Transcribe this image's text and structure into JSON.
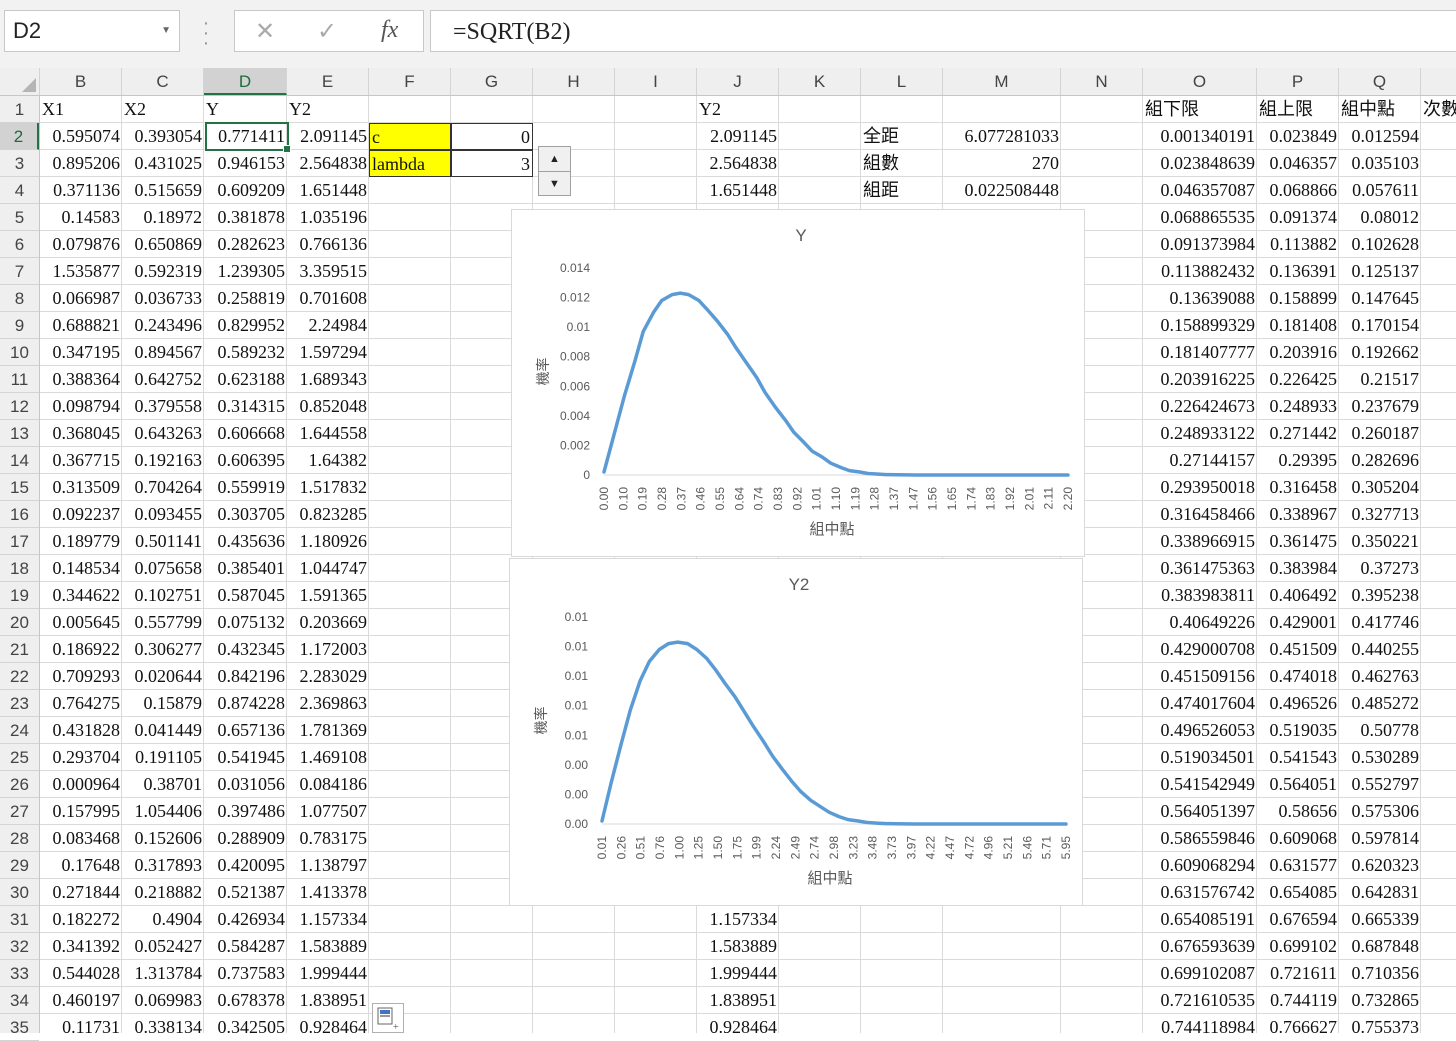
{
  "name_box": "D2",
  "formula": "=SQRT(B2)",
  "toolbar": {
    "cancel": "✕",
    "enter": "✓",
    "fx": "fx"
  },
  "columns": [
    "B",
    "C",
    "D",
    "E",
    "F",
    "G",
    "H",
    "I",
    "J",
    "K",
    "L",
    "M",
    "N",
    "O",
    "P",
    "Q"
  ],
  "selected_column": "D",
  "rows": [
    "1",
    "2",
    "3",
    "4",
    "5",
    "6",
    "7",
    "8",
    "9",
    "10",
    "11",
    "12",
    "13",
    "14",
    "15",
    "16",
    "17",
    "18",
    "19",
    "20",
    "21",
    "22",
    "23",
    "24",
    "25",
    "26",
    "27",
    "28",
    "29",
    "30",
    "31",
    "32",
    "33",
    "34",
    "35"
  ],
  "selected_row": "2",
  "headers": {
    "B": "X1",
    "C": "X2",
    "D": "Y",
    "E": "Y2",
    "J": "Y2",
    "O": "組下限",
    "P": "組上限",
    "Q": "組中點",
    "R": "次數"
  },
  "data_rows": [
    [
      "0.595074",
      "0.393054",
      "0.771411",
      "2.091145"
    ],
    [
      "0.895206",
      "0.431025",
      "0.946153",
      "2.564838"
    ],
    [
      "0.371136",
      "0.515659",
      "0.609209",
      "1.651448"
    ],
    [
      "0.14583",
      "0.18972",
      "0.381878",
      "1.035196"
    ],
    [
      "0.079876",
      "0.650869",
      "0.282623",
      "0.766136"
    ],
    [
      "1.535877",
      "0.592319",
      "1.239305",
      "3.359515"
    ],
    [
      "0.066987",
      "0.036733",
      "0.258819",
      "0.701608"
    ],
    [
      "0.688821",
      "0.243496",
      "0.829952",
      "2.24984"
    ],
    [
      "0.347195",
      "0.894567",
      "0.589232",
      "1.597294"
    ],
    [
      "0.388364",
      "0.642752",
      "0.623188",
      "1.689343"
    ],
    [
      "0.098794",
      "0.379558",
      "0.314315",
      "0.852048"
    ],
    [
      "0.368045",
      "0.643263",
      "0.606668",
      "1.644558"
    ],
    [
      "0.367715",
      "0.192163",
      "0.606395",
      "1.64382"
    ],
    [
      "0.313509",
      "0.704264",
      "0.559919",
      "1.517832"
    ],
    [
      "0.092237",
      "0.093455",
      "0.303705",
      "0.823285"
    ],
    [
      "0.189779",
      "0.501141",
      "0.435636",
      "1.180926"
    ],
    [
      "0.148534",
      "0.075658",
      "0.385401",
      "1.044747"
    ],
    [
      "0.344622",
      "0.102751",
      "0.587045",
      "1.591365"
    ],
    [
      "0.005645",
      "0.557799",
      "0.075132",
      "0.203669"
    ],
    [
      "0.186922",
      "0.306277",
      "0.432345",
      "1.172003"
    ],
    [
      "0.709293",
      "0.020644",
      "0.842196",
      "2.283029"
    ],
    [
      "0.764275",
      "0.15879",
      "0.874228",
      "2.369863"
    ],
    [
      "0.431828",
      "0.041449",
      "0.657136",
      "1.781369"
    ],
    [
      "0.293704",
      "0.191105",
      "0.541945",
      "1.469108"
    ],
    [
      "0.000964",
      "0.38701",
      "0.031056",
      "0.084186"
    ],
    [
      "0.157995",
      "1.054406",
      "0.397486",
      "1.077507"
    ],
    [
      "0.083468",
      "0.152606",
      "0.288909",
      "0.783175"
    ],
    [
      "0.17648",
      "0.317893",
      "0.420095",
      "1.138797"
    ],
    [
      "0.271844",
      "0.218882",
      "0.521387",
      "1.413378"
    ],
    [
      "0.182272",
      "0.4904",
      "0.426934",
      "1.157334"
    ],
    [
      "0.341392",
      "0.052427",
      "0.584287",
      "1.583889"
    ],
    [
      "0.544028",
      "1.313784",
      "0.737583",
      "1.999444"
    ],
    [
      "0.460197",
      "0.069983",
      "0.678378",
      "1.838951"
    ],
    [
      "0.11731",
      "0.338134",
      "0.342505",
      "0.928464"
    ]
  ],
  "params": {
    "c_label": "c",
    "c_value": "0",
    "lambda_label": "lambda",
    "lambda_value": "3"
  },
  "j_values": {
    "row2": "2.091145",
    "row3": "2.564838",
    "row4": "1.651448",
    "row31": "1.157334",
    "row32": "1.583889",
    "row33": "1.999444",
    "row34": "1.838951",
    "row35": "0.928464"
  },
  "stats": [
    {
      "label": "全距",
      "value": "6.077281033"
    },
    {
      "label": "組數",
      "value": "270"
    },
    {
      "label": "組距",
      "value": "0.022508448"
    }
  ],
  "bins": [
    [
      "0.001340191",
      "0.023849",
      "0.012594"
    ],
    [
      "0.023848639",
      "0.046357",
      "0.035103"
    ],
    [
      "0.046357087",
      "0.068866",
      "0.057611"
    ],
    [
      "0.068865535",
      "0.091374",
      "0.08012"
    ],
    [
      "0.091373984",
      "0.113882",
      "0.102628"
    ],
    [
      "0.113882432",
      "0.136391",
      "0.125137"
    ],
    [
      "0.13639088",
      "0.158899",
      "0.147645"
    ],
    [
      "0.158899329",
      "0.181408",
      "0.170154"
    ],
    [
      "0.181407777",
      "0.203916",
      "0.192662"
    ],
    [
      "0.203916225",
      "0.226425",
      "0.21517"
    ],
    [
      "0.226424673",
      "0.248933",
      "0.237679"
    ],
    [
      "0.248933122",
      "0.271442",
      "0.260187"
    ],
    [
      "0.27144157",
      "0.29395",
      "0.282696"
    ],
    [
      "0.293950018",
      "0.316458",
      "0.305204"
    ],
    [
      "0.316458466",
      "0.338967",
      "0.327713"
    ],
    [
      "0.338966915",
      "0.361475",
      "0.350221"
    ],
    [
      "0.361475363",
      "0.383984",
      "0.37273"
    ],
    [
      "0.383983811",
      "0.406492",
      "0.395238"
    ],
    [
      "0.40649226",
      "0.429001",
      "0.417746"
    ],
    [
      "0.429000708",
      "0.451509",
      "0.440255"
    ],
    [
      "0.451509156",
      "0.474018",
      "0.462763"
    ],
    [
      "0.474017604",
      "0.496526",
      "0.485272"
    ],
    [
      "0.496526053",
      "0.519035",
      "0.50778"
    ],
    [
      "0.519034501",
      "0.541543",
      "0.530289"
    ],
    [
      "0.541542949",
      "0.564051",
      "0.552797"
    ],
    [
      "0.564051397",
      "0.58656",
      "0.575306"
    ],
    [
      "0.586559846",
      "0.609068",
      "0.597814"
    ],
    [
      "0.609068294",
      "0.631577",
      "0.620323"
    ],
    [
      "0.631576742",
      "0.654085",
      "0.642831"
    ],
    [
      "0.654085191",
      "0.676594",
      "0.665339"
    ],
    [
      "0.676593639",
      "0.699102",
      "0.687848"
    ],
    [
      "0.699102087",
      "0.721611",
      "0.710356"
    ],
    [
      "0.721610535",
      "0.744119",
      "0.732865"
    ],
    [
      "0.744118984",
      "0.766627",
      "0.755373"
    ]
  ],
  "icons": {
    "spinner_up": "spin-up-icon",
    "spinner_down": "spin-down-icon",
    "paste_options": "paste-options-icon"
  },
  "colors": {
    "line": "#5b9bd5",
    "param_fill": "#ffff00",
    "selection": "#217346"
  },
  "chart_data": [
    {
      "type": "line",
      "title": "Y",
      "xlabel": "組中點",
      "ylabel": "機率",
      "ylim": [
        0,
        0.014
      ],
      "yticks": [
        "0",
        "0.002",
        "0.004",
        "0.006",
        "0.008",
        "0.01",
        "0.012",
        "0.014"
      ],
      "xticks": [
        "0.00",
        "0.10",
        "0.19",
        "0.28",
        "0.37",
        "0.46",
        "0.55",
        "0.64",
        "0.74",
        "0.83",
        "0.92",
        "1.01",
        "1.10",
        "1.19",
        "1.28",
        "1.37",
        "1.47",
        "1.56",
        "1.65",
        "1.74",
        "1.83",
        "1.92",
        "2.01",
        "2.11",
        "2.20"
      ],
      "x": [
        0.0,
        0.05,
        0.1,
        0.15,
        0.19,
        0.24,
        0.28,
        0.33,
        0.37,
        0.41,
        0.46,
        0.5,
        0.55,
        0.6,
        0.64,
        0.69,
        0.74,
        0.78,
        0.83,
        0.88,
        0.92,
        0.97,
        1.01,
        1.06,
        1.1,
        1.15,
        1.19,
        1.24,
        1.28,
        1.33,
        1.37,
        1.42,
        1.47,
        1.51,
        1.56,
        1.6,
        1.65,
        1.7,
        1.74,
        1.79,
        1.83,
        1.88,
        1.92,
        1.97,
        2.01,
        2.06,
        2.11,
        2.15,
        2.2,
        2.25
      ],
      "values": [
        0.0002,
        0.0028,
        0.0054,
        0.0077,
        0.0097,
        0.011,
        0.0118,
        0.0122,
        0.0123,
        0.0122,
        0.0118,
        0.0112,
        0.0104,
        0.0095,
        0.0086,
        0.0076,
        0.0066,
        0.0056,
        0.0046,
        0.0037,
        0.0029,
        0.0022,
        0.0016,
        0.0012,
        0.0008,
        0.0005,
        0.0003,
        0.0002,
        0.0001,
        6e-05,
        3e-05,
        2e-05,
        1e-05,
        0,
        0,
        0,
        0,
        0,
        0,
        0,
        0,
        0,
        0,
        0,
        0,
        0,
        0,
        0,
        0,
        0
      ]
    },
    {
      "type": "line",
      "title": "Y2",
      "xlabel": "組中點",
      "ylabel": "機率",
      "ylim": [
        0,
        0.014
      ],
      "yticks": [
        "0.00",
        "0.00",
        "0.00",
        "0.01",
        "0.01",
        "0.01",
        "0.01",
        "0.01"
      ],
      "xticks": [
        "0.01",
        "0.26",
        "0.51",
        "0.76",
        "1.00",
        "1.25",
        "1.50",
        "1.75",
        "1.99",
        "2.24",
        "2.49",
        "2.74",
        "2.98",
        "3.23",
        "3.48",
        "3.73",
        "3.97",
        "4.22",
        "4.47",
        "4.72",
        "4.96",
        "5.21",
        "5.46",
        "5.71",
        "5.95"
      ],
      "x": [
        0.01,
        0.13,
        0.26,
        0.38,
        0.51,
        0.63,
        0.76,
        0.88,
        1.0,
        1.13,
        1.25,
        1.38,
        1.5,
        1.62,
        1.75,
        1.87,
        1.99,
        2.12,
        2.24,
        2.37,
        2.49,
        2.61,
        2.74,
        2.86,
        2.98,
        3.11,
        3.23,
        3.36,
        3.48,
        3.6,
        3.73,
        3.85,
        3.97,
        4.1,
        4.22,
        4.35,
        4.47,
        4.59,
        4.72,
        4.84,
        4.96,
        5.09,
        5.21,
        5.34,
        5.46,
        5.58,
        5.71,
        5.83,
        5.95,
        6.08
      ],
      "values": [
        0.0002,
        0.0028,
        0.0054,
        0.0077,
        0.0097,
        0.011,
        0.0118,
        0.0122,
        0.0123,
        0.0122,
        0.0118,
        0.0112,
        0.0104,
        0.0095,
        0.0086,
        0.0076,
        0.0066,
        0.0056,
        0.0046,
        0.0037,
        0.0029,
        0.0022,
        0.0016,
        0.0012,
        0.0008,
        0.0005,
        0.0003,
        0.0002,
        0.0001,
        6e-05,
        3e-05,
        2e-05,
        1e-05,
        0,
        0,
        0,
        0,
        0,
        0,
        0,
        0,
        0,
        0,
        0,
        0,
        0,
        0,
        0,
        0,
        0
      ]
    }
  ]
}
